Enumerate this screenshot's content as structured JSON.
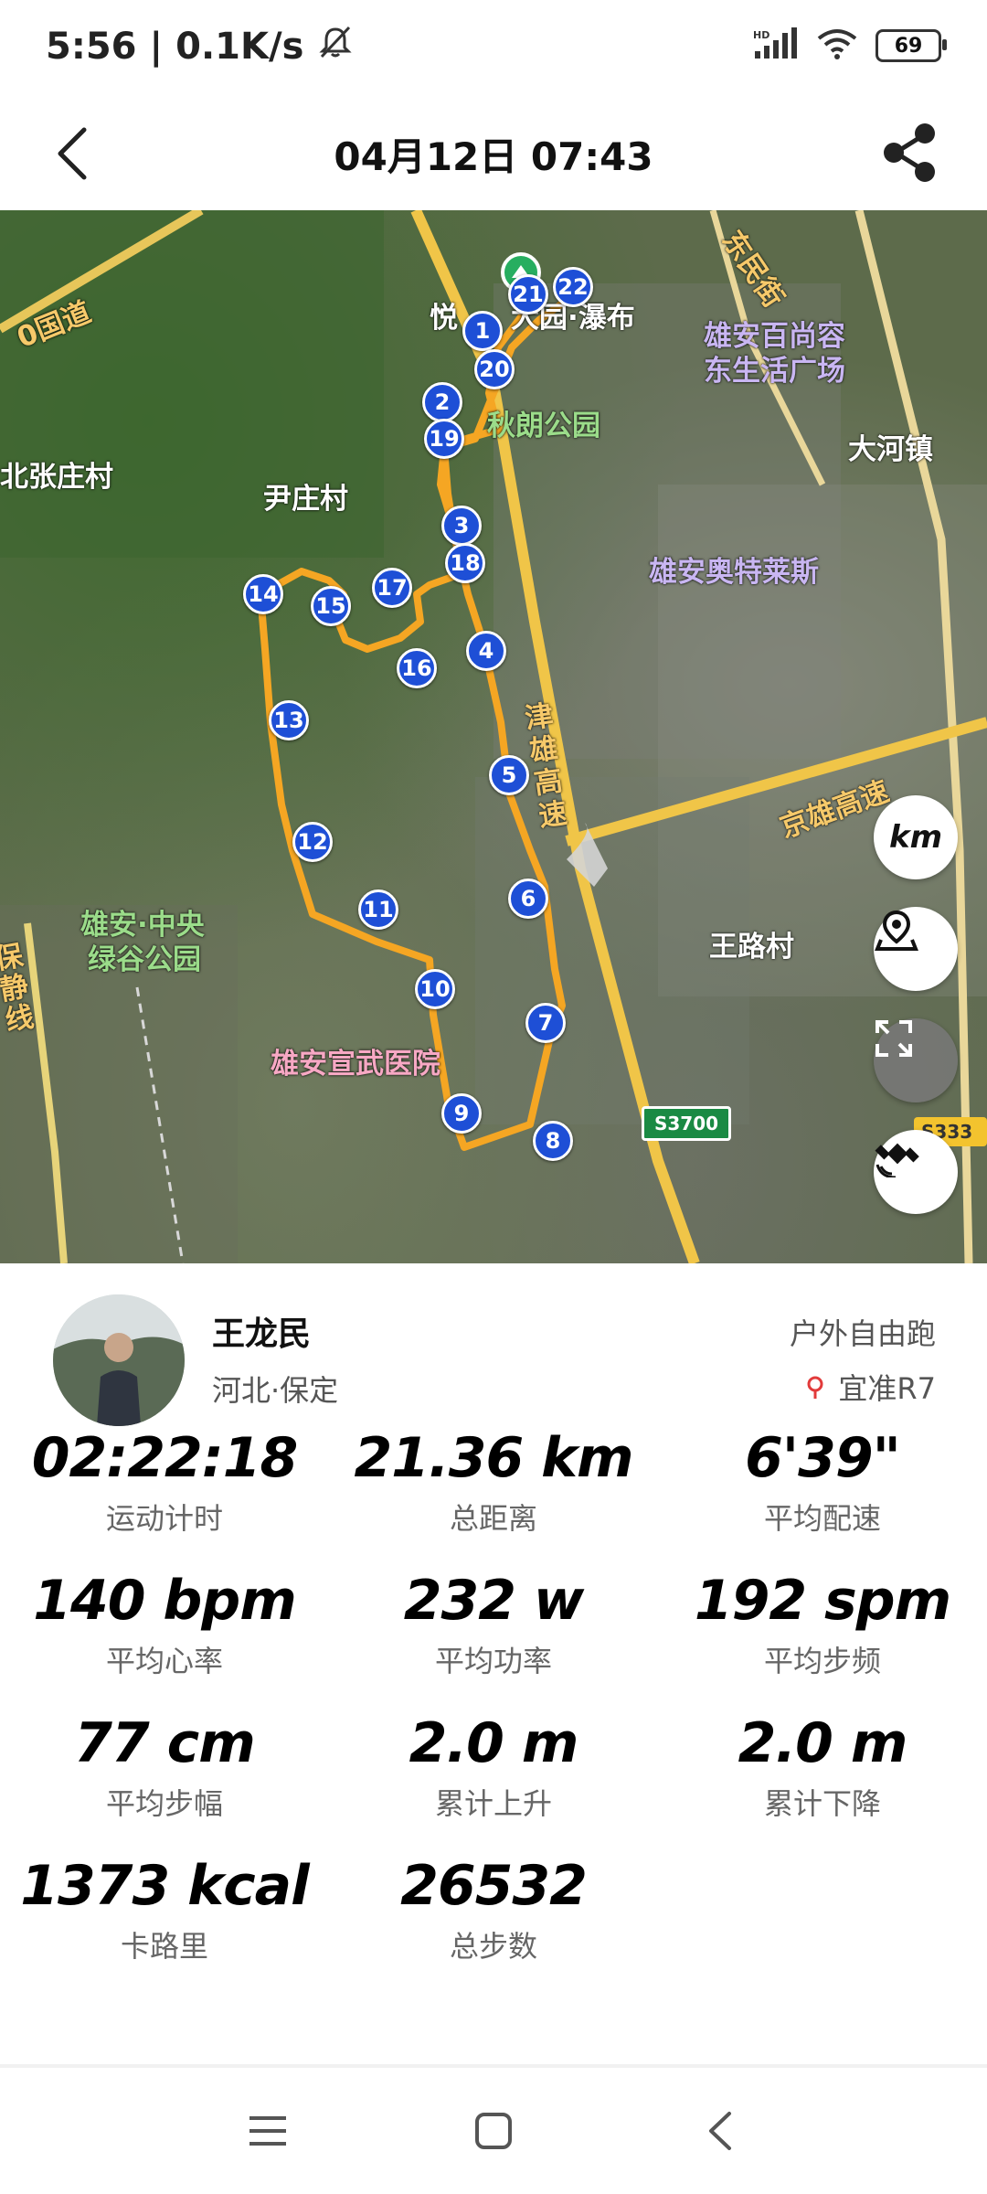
{
  "status_bar": {
    "time": "5:56",
    "network_speed": "0.1K/s",
    "signal_label": "HD",
    "battery": "69"
  },
  "header": {
    "title": "04月12日 07:43"
  },
  "map": {
    "labels": {
      "road_national": "0国道",
      "park_top": "悦",
      "park_top_suffix": "大园·瀑布",
      "qiulang_park": "秋朗公园",
      "bai_shang_1": "雄安百尚容",
      "bai_shang_2": "东生活广场",
      "dahe_town": "大河镇",
      "beizhang_village": "北张庄村",
      "yinzhuang_village": "尹庄村",
      "outlets": "雄安奥特莱斯",
      "jinxiong_highway": "津雄高速",
      "jingxiong_highway": "京雄高速",
      "wanglu_village": "王路村",
      "central_park_1": "雄安·中央",
      "central_park_2": "绿谷公园",
      "xuanwu_hospital": "雄安宣武医院",
      "side_road": "保静线",
      "top_road_right": "东民街",
      "s3700": "S3700",
      "s333": "S333"
    },
    "km_markers": [
      "1",
      "2",
      "3",
      "4",
      "5",
      "6",
      "7",
      "8",
      "9",
      "10",
      "11",
      "12",
      "13",
      "14",
      "15",
      "16",
      "17",
      "18",
      "19",
      "20",
      "21",
      "22"
    ],
    "km_button": "km"
  },
  "profile": {
    "name": "王龙民",
    "location": "河北·保定",
    "activity_type": "户外自由跑",
    "device": "宜准R7"
  },
  "stats": [
    {
      "value": "02:22:18",
      "label": "运动计时"
    },
    {
      "value": "21.36 km",
      "label": "总距离"
    },
    {
      "value": "6'39\"",
      "label": "平均配速"
    },
    {
      "value": "140 bpm",
      "label": "平均心率"
    },
    {
      "value": "232 w",
      "label": "平均功率"
    },
    {
      "value": "192 spm",
      "label": "平均步频"
    },
    {
      "value": "77 cm",
      "label": "平均步幅"
    },
    {
      "value": "2.0 m",
      "label": "累计上升"
    },
    {
      "value": "2.0 m",
      "label": "累计下降"
    },
    {
      "value": "1373 kcal",
      "label": "卡路里"
    },
    {
      "value": "26532",
      "label": "总步数"
    }
  ],
  "colors": {
    "route": "#f5a623",
    "marker": "#1e4fd6",
    "road": "#f1c84b"
  }
}
